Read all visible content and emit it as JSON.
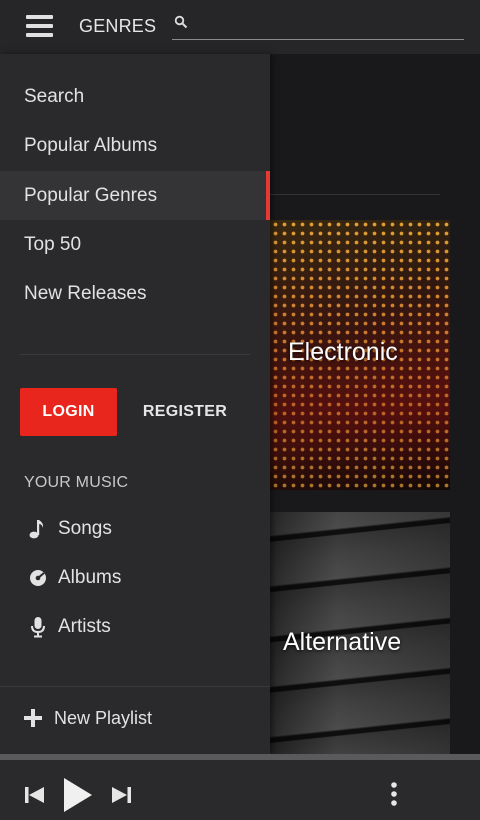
{
  "header": {
    "title": "GENRES",
    "search_value": "",
    "search_placeholder": ""
  },
  "drawer": {
    "nav_items": [
      {
        "label": "Search",
        "active": false
      },
      {
        "label": "Popular Albums",
        "active": false
      },
      {
        "label": "Popular Genres",
        "active": true
      },
      {
        "label": "Top 50",
        "active": false
      },
      {
        "label": "New Releases",
        "active": false
      }
    ],
    "login_label": "LOGIN",
    "register_label": "REGISTER",
    "section_title": "YOUR MUSIC",
    "music_items": [
      {
        "label": "Songs",
        "icon": "music-note-icon"
      },
      {
        "label": "Albums",
        "icon": "album-disc-icon"
      },
      {
        "label": "Artists",
        "icon": "microphone-icon"
      }
    ],
    "new_playlist_label": "New Playlist"
  },
  "genres": [
    {
      "name": "Electronic"
    },
    {
      "name": "Alternative"
    }
  ],
  "player": {
    "controls": [
      "skip-previous-icon",
      "play-icon",
      "skip-next-icon",
      "more-vert-icon"
    ]
  },
  "colors": {
    "accent": "#e8261d",
    "drawer_bg": "#2a2a2c",
    "topbar_bg": "#262628"
  }
}
